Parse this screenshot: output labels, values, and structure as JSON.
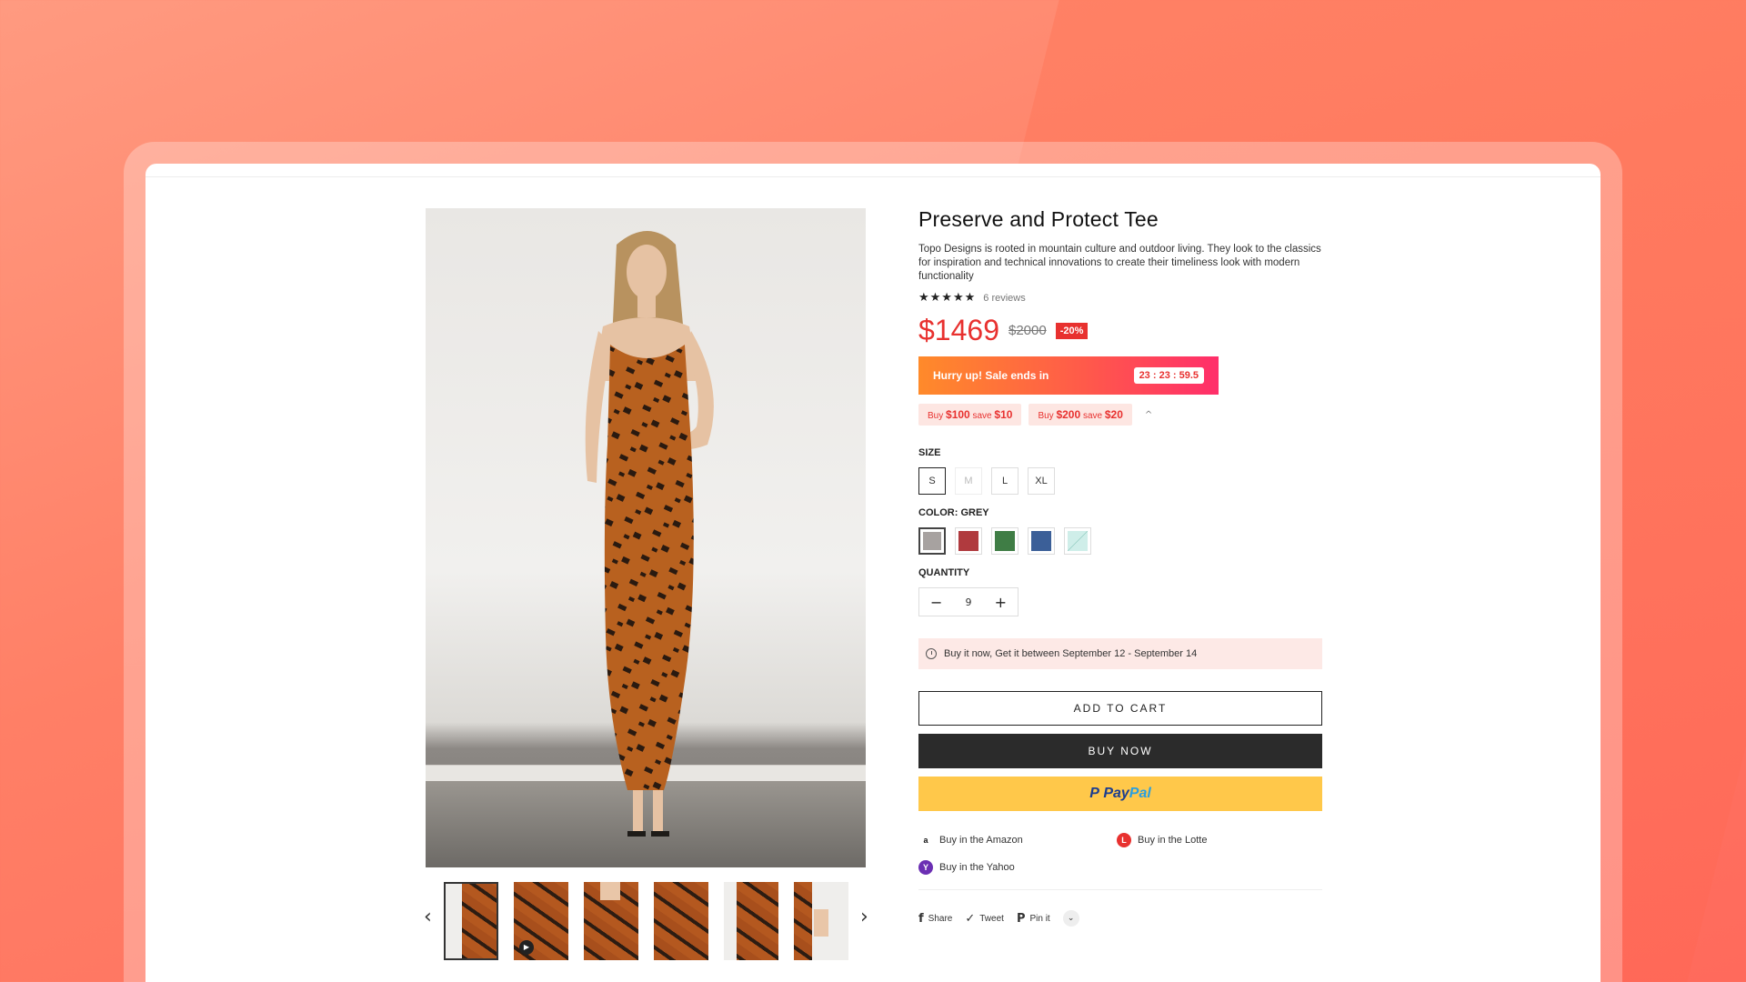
{
  "product": {
    "title": "Preserve and Protect Tee",
    "description": "Topo Designs is rooted in mountain culture and outdoor living. They look to the classics for inspiration and technical innovations to create their timeliness look with modern functionality",
    "stars": "★★★★★",
    "reviews": "6 reviews",
    "price": "$1469",
    "old_price": "$2000",
    "discount": "-20%"
  },
  "sale": {
    "text": "Hurry up! Sale ends in",
    "timer": "23 : 23 : 59.5"
  },
  "deals": [
    {
      "buy": "Buy",
      "amount": "$100",
      "save": "save",
      "value": "$10"
    },
    {
      "buy": "Buy",
      "amount": "$200",
      "save": "save",
      "value": "$20"
    }
  ],
  "deals_toggle": "^",
  "size": {
    "label": "SIZE",
    "options": [
      "S",
      "M",
      "L",
      "XL"
    ],
    "selected": "S",
    "disabled": [
      "M"
    ]
  },
  "color": {
    "label": "COLOR: GREY",
    "swatches": [
      {
        "name": "grey",
        "hex": "#a7a2a0"
      },
      {
        "name": "red",
        "hex": "#b03a3e"
      },
      {
        "name": "green",
        "hex": "#3f7d45"
      },
      {
        "name": "blue",
        "hex": "#3b5f98"
      },
      {
        "name": "mint",
        "hex": "#cfeee9"
      }
    ]
  },
  "quantity": {
    "label": "QUANTITY",
    "value": "9",
    "minus": "−",
    "plus": "+"
  },
  "delivery": "Buy it now, Get it between September 12 - September 14",
  "buttons": {
    "add_to_cart": "ADD TO CART",
    "buy_now": "BUY NOW",
    "paypal_p": "P",
    "paypal_pay": "Pay",
    "paypal_pal": "Pal"
  },
  "stores": [
    {
      "label": "Buy in the Amazon",
      "icon": "amazon-icon",
      "glyph": "a",
      "color": "#ffffff"
    },
    {
      "label": "Buy in the Lotte",
      "icon": "lotte-icon",
      "glyph": "L",
      "color": "#e8312f"
    },
    {
      "label": "Buy in the Yahoo",
      "icon": "yahoo-icon",
      "glyph": "Y",
      "color": "#6b2fb3"
    }
  ],
  "share": [
    {
      "label": "Share",
      "icon": "facebook-icon",
      "glyph": "f"
    },
    {
      "label": "Tweet",
      "icon": "twitter-icon",
      "glyph": "✓"
    },
    {
      "label": "Pin it",
      "icon": "pinterest-icon",
      "glyph": "P"
    }
  ],
  "share_more": "⌄",
  "gallery": {
    "prev": "‹",
    "next": "›"
  },
  "colors": {
    "accent": "#e8312f",
    "dark_button": "#2b2b2b",
    "paypal": "#ffc84a"
  }
}
